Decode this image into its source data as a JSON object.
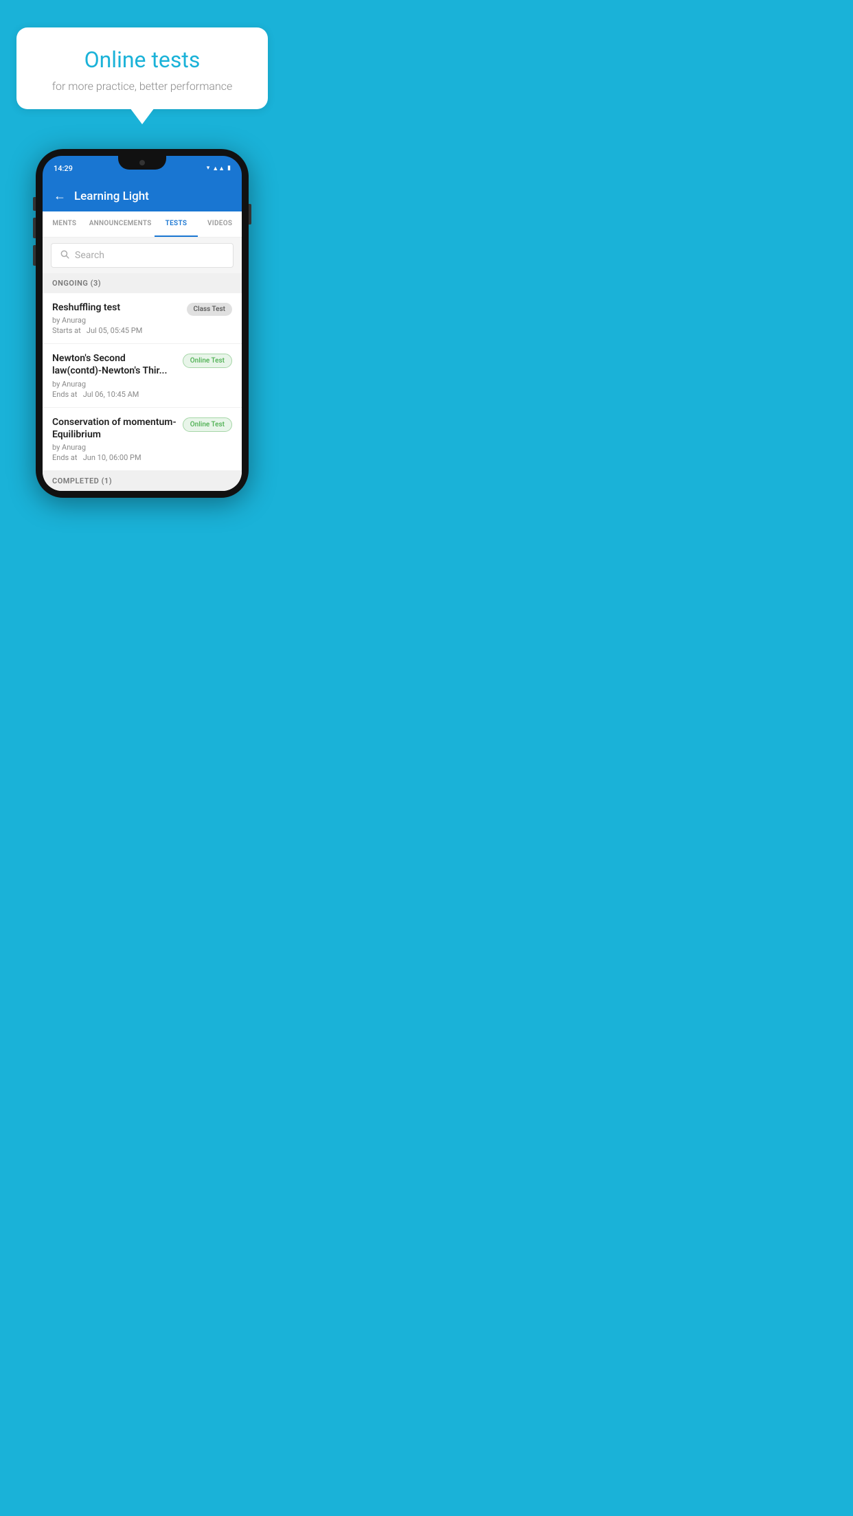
{
  "background_color": "#1ab2d8",
  "hero": {
    "bubble_title": "Online tests",
    "bubble_subtitle": "for more practice, better performance"
  },
  "phone": {
    "status_bar": {
      "time": "14:29",
      "icons": [
        "wifi",
        "signal",
        "battery"
      ]
    },
    "app_bar": {
      "title": "Learning Light",
      "back_label": "←"
    },
    "tabs": [
      {
        "label": "MENTS",
        "active": false
      },
      {
        "label": "ANNOUNCEMENTS",
        "active": false
      },
      {
        "label": "TESTS",
        "active": true
      },
      {
        "label": "VIDEOS",
        "active": false
      }
    ],
    "search": {
      "placeholder": "Search"
    },
    "ongoing_section": {
      "header": "ONGOING (3)",
      "items": [
        {
          "name": "Reshuffling test",
          "by": "by Anurag",
          "date": "Starts at  Jul 05, 05:45 PM",
          "badge": "Class Test",
          "badge_type": "class"
        },
        {
          "name": "Newton's Second law(contd)-Newton's Thir...",
          "by": "by Anurag",
          "date": "Ends at  Jul 06, 10:45 AM",
          "badge": "Online Test",
          "badge_type": "online"
        },
        {
          "name": "Conservation of momentum-Equilibrium",
          "by": "by Anurag",
          "date": "Ends at  Jun 10, 06:00 PM",
          "badge": "Online Test",
          "badge_type": "online"
        }
      ]
    },
    "completed_section": {
      "header": "COMPLETED (1)"
    }
  }
}
